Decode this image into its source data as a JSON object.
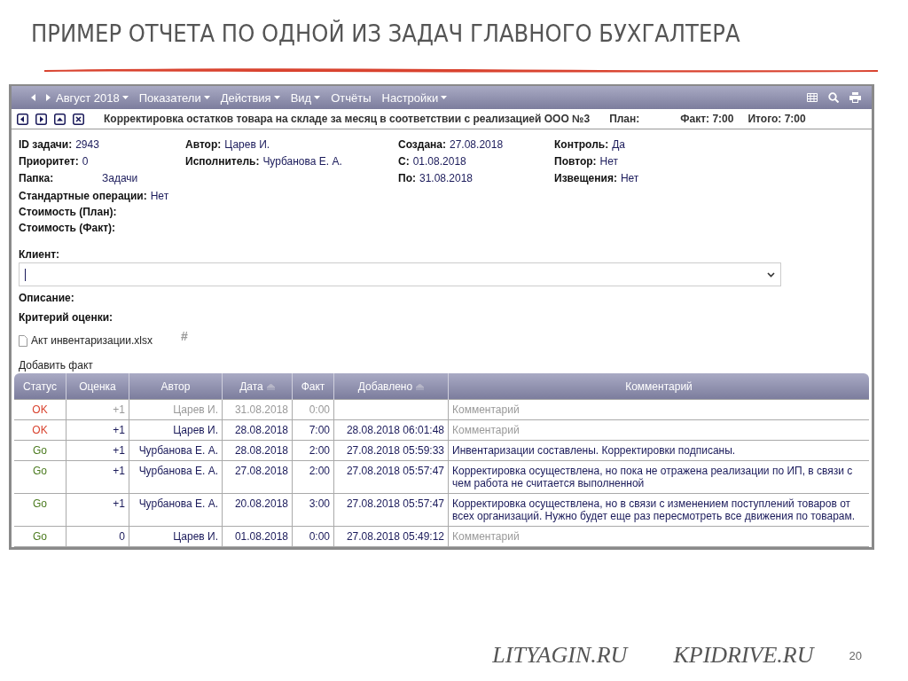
{
  "slide": {
    "title": "ПРИМЕР ОТЧЕТА ПО ОДНОЙ ИЗ ЗАДАЧ ГЛАВНОГО БУХГАЛТЕРА",
    "footer_links": [
      "LITYAGIN.RU",
      "KPIDRIVE.RU"
    ],
    "page_number": "20"
  },
  "toolbar": {
    "period": "Август 2018",
    "menus": [
      {
        "label": "Показатели",
        "dropdown": true
      },
      {
        "label": "Действия",
        "dropdown": true
      },
      {
        "label": "Вид",
        "dropdown": true
      },
      {
        "label": "Отчёты",
        "dropdown": false
      },
      {
        "label": "Настройки",
        "dropdown": true
      }
    ]
  },
  "task_header": {
    "title": "Корректировка остатков товара на складе за месяц в соответствии с реализацией ООО №3",
    "totals": [
      {
        "label": "План:"
      },
      {
        "label": "Факт:",
        "value": "7:00"
      },
      {
        "label": "Итого:",
        "value": "7:00"
      }
    ]
  },
  "details": [
    [
      {
        "label": "ID задачи:",
        "value": "2943"
      },
      {
        "label": "Приоритет:",
        "value": "0"
      },
      {
        "label": "Папка:",
        "value": "Задачи"
      }
    ],
    [
      {
        "label": "Автор:",
        "value": "Царев И."
      },
      {
        "label": "Исполнитель:",
        "value": "Чурбанова Е. А."
      }
    ],
    [
      {
        "label": "Создана:",
        "value": "27.08.2018"
      },
      {
        "label": "С:",
        "value": "01.08.2018"
      },
      {
        "label": "По:",
        "value": "31.08.2018"
      }
    ],
    [
      {
        "label": "Контроль:",
        "value": "Да"
      },
      {
        "label": "Повтор:",
        "value": "Нет"
      },
      {
        "label": "Извещения:",
        "value": "Нет"
      }
    ]
  ],
  "extra_fields": [
    {
      "label": "Стандартные операции:",
      "value": "Нет"
    },
    {
      "label": "Стоимость (План):"
    },
    {
      "label": "Стоимость (Факт):"
    }
  ],
  "client": {
    "label": "Клиент:"
  },
  "description": {
    "label": "Описание:"
  },
  "criteria": {
    "label": "Критерий оценки:"
  },
  "attachment": {
    "name": "Акт инвентаризации.xlsx",
    "hash": "#"
  },
  "add_fact": "Добавить факт",
  "table": {
    "columns": [
      {
        "label": "Статус",
        "sortable": false
      },
      {
        "label": "Оценка",
        "sortable": false
      },
      {
        "label": "Автор",
        "sortable": false
      },
      {
        "label": "Дата",
        "sortable": true
      },
      {
        "label": "Факт",
        "sortable": false
      },
      {
        "label": "Добавлено",
        "sortable": true
      },
      {
        "label": "Комментарий",
        "sortable": false
      }
    ],
    "rows": [
      {
        "status": "OK",
        "color": "#d9432f",
        "score": "+1",
        "author": "Царев И.",
        "date": "31.08.2018",
        "fact": "0:00",
        "muted": true,
        "placeholder": "Комментарий"
      },
      {
        "status": "OK",
        "color": "#d9432f",
        "score": "+1",
        "author": "Царев И.",
        "date": "28.08.2018",
        "fact": "7:00",
        "added": "28.08.2018 06:01:48",
        "muted": false,
        "placeholder": "Комментарий"
      },
      {
        "status": "Go",
        "color": "#4a7a1e",
        "score": "+1",
        "author": "Чурбанова Е. А.",
        "date": "28.08.2018",
        "fact": "2:00",
        "added": "27.08.2018 05:59:33",
        "muted": false,
        "comment": "Инвентаризации составлены. Корректировки подписаны."
      },
      {
        "status": "Go",
        "color": "#4a7a1e",
        "score": "+1",
        "author": "Чурбанова Е. А.",
        "date": "27.08.2018",
        "fact": "2:00",
        "added": "27.08.2018 05:57:47",
        "muted": false,
        "comment": "Корректировка осуществлена, но пока не отражена реализации по ИП, в связи с чем работа не считается выполненной"
      },
      {
        "status": "Go",
        "color": "#4a7a1e",
        "score": "+1",
        "author": "Чурбанова Е. А.",
        "date": "20.08.2018",
        "fact": "3:00",
        "added": "27.08.2018 05:57:47",
        "muted": false,
        "comment": "Корректировка осуществлена, но в связи с изменением поступлений товаров от всех организаций. Нужно будет еще раз пересмотреть все движения по товарам."
      },
      {
        "status": "Go",
        "color": "#4a7a1e",
        "score": "0",
        "author": "Царев И.",
        "date": "01.08.2018",
        "fact": "0:00",
        "added": "27.08.2018 05:49:12",
        "muted": false,
        "placeholder": "Комментарий"
      }
    ]
  }
}
